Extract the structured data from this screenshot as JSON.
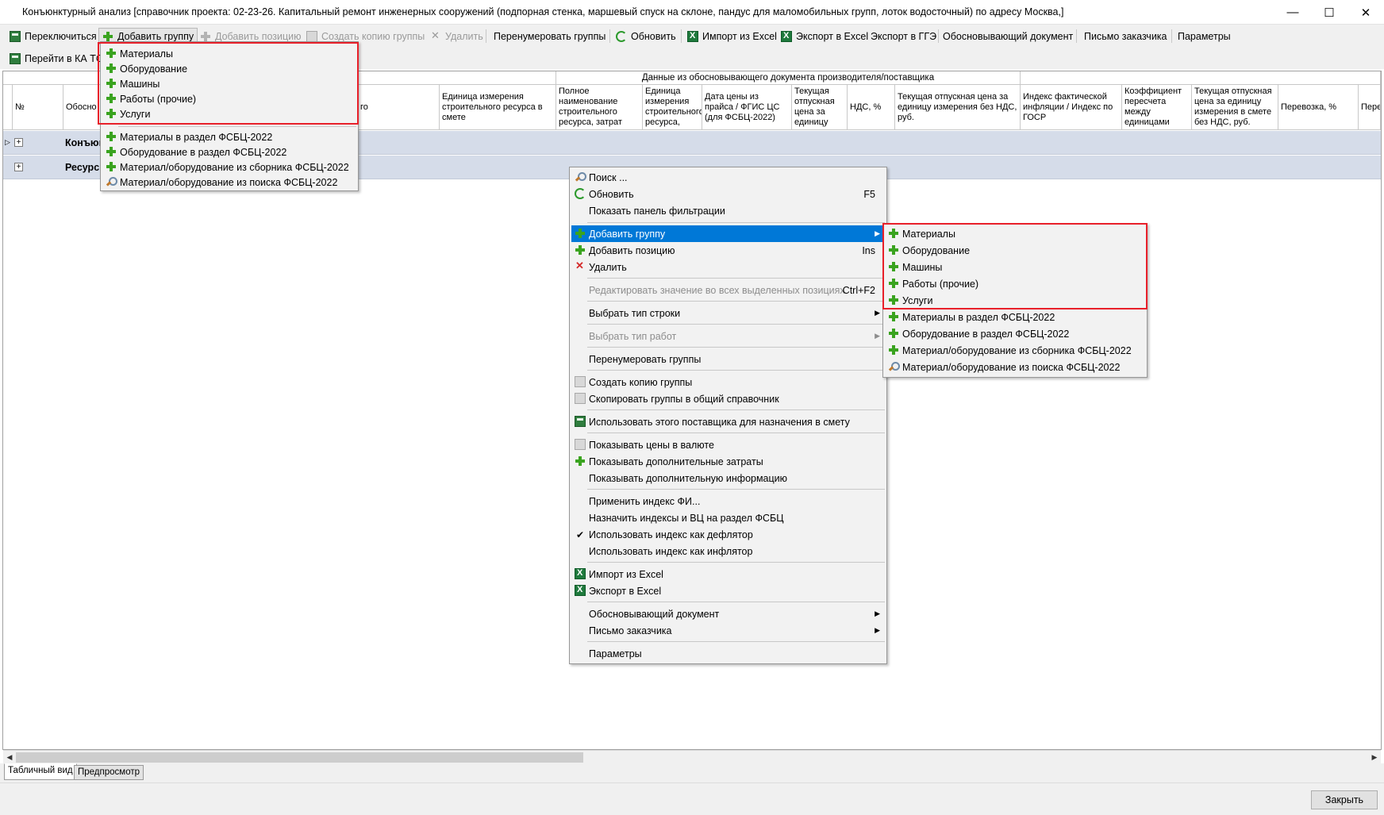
{
  "window": {
    "title": "Конъюнктурный анализ [справочник проекта: 02-23-26. Капитальный ремонт инженерных сооружений (подпорная стенка, маршевый спуск на склоне, пандус для маломобильных групп, лоток водосточный) по адресу Москва,]",
    "minimize": "—",
    "maximize": "☐",
    "close": "✕"
  },
  "toolbar1": {
    "switch": "Переключиться",
    "add_group": "Добавить группу",
    "add_position": "Добавить позицию",
    "create_copy": "Создать копию группы",
    "delete": "Удалить",
    "renumber": "Перенумеровать группы",
    "refresh": "Обновить",
    "import_excel": "Импорт из Excel",
    "export_excel": "Экспорт в Excel",
    "export_gge": "Экспорт в ГГЭ",
    "basis_doc": "Обосновывающий документ",
    "customer_letter": "Письмо заказчика",
    "params": "Параметры"
  },
  "toolbar2": {
    "goto_ka": "Перейти в КА ТС"
  },
  "grid": {
    "group_header": "Данные из обосновывающего документа производителя/поставщика",
    "columns": {
      "num": "№",
      "basis": "Обосно",
      "basis_tail": "го",
      "unit": "Единица измерения строительного ресурса в смете",
      "full_name": "Полное наименование строительного ресурса, затрат",
      "unit2": "Единица измерения строительного ресурса,",
      "price_date": "Дата цены из прайса / ФГИС ЦС (для ФСБЦ-2022)",
      "cur_price": "Текущая отпускная цена за единицу",
      "vat": "НДС, %",
      "cur_price_novat": "Текущая отпускная цена за единицу измерения без НДС, руб.",
      "index": "Индекс фактической инфляции / Индекс по ГОСР",
      "coef": "Коэффициент пересчета между единицами",
      "cur_price_est": "Текущая отпускная цена за единицу измерения в смете без НДС, руб.",
      "transport": "Перевозка, %",
      "more": "Пере"
    },
    "rows": [
      {
        "label": "Конъюн"
      },
      {
        "label": "Ресурсы"
      }
    ]
  },
  "dropdown_menu": {
    "items": [
      "Материалы",
      "Оборудование",
      "Машины",
      "Работы (прочие)",
      "Услуги"
    ],
    "fsbc_items": [
      "Материалы в раздел ФСБЦ-2022",
      "Оборудование в раздел ФСБЦ-2022",
      "Материал/оборудование из сборника ФСБЦ-2022"
    ],
    "search_item": "Материал/оборудование из поиска ФСБЦ-2022"
  },
  "context_menu": {
    "search": "Поиск ...",
    "refresh": "Обновить",
    "refresh_sc": "F5",
    "filter_panel": "Показать панель фильтрации",
    "add_group": "Добавить группу",
    "add_position": "Добавить позицию",
    "add_position_sc": "Ins",
    "delete": "Удалить",
    "edit_all": "Редактировать значение во всех выделенных позициях",
    "edit_all_sc": "Ctrl+F2",
    "row_type": "Выбрать тип строки",
    "work_type": "Выбрать тип работ",
    "renumber": "Перенумеровать группы",
    "create_copy": "Создать копию группы",
    "copy_to_common": "Скопировать группы в общий справочник",
    "use_supplier": "Использовать этого поставщика для назначения в смету",
    "show_currency": "Показывать цены в валюте",
    "show_extra_costs": "Показывать дополнительные затраты",
    "show_extra_info": "Показывать дополнительную информацию",
    "apply_index": "Применить индекс ФИ...",
    "assign_index": "Назначить индексы и ВЦ на раздел ФСБЦ",
    "index_deflator": "Использовать индекс как дефлятор",
    "index_inflator": "Использовать индекс как инфлятор",
    "import_excel": "Импорт из Excel",
    "export_excel": "Экспорт в Excel",
    "basis_doc": "Обосновывающий документ",
    "customer_letter": "Письмо заказчика",
    "params": "Параметры",
    "checkmark": "✔"
  },
  "submenu": {
    "items": [
      "Материалы",
      "Оборудование",
      "Машины",
      "Работы (прочие)",
      "Услуги"
    ],
    "fsbc_items": [
      "Материалы в раздел ФСБЦ-2022",
      "Оборудование в раздел ФСБЦ-2022",
      "Материал/оборудование из сборника ФСБЦ-2022"
    ],
    "search_item": "Материал/оборудование из поиска ФСБЦ-2022"
  },
  "tabs": {
    "table_view": "Табличный вид",
    "preview": "Предпросмотр"
  },
  "footer": {
    "close": "Закрыть"
  },
  "colors": {
    "accent": "#0078d7",
    "highlight_box": "#e8202a",
    "row_bg": "#d5dce9",
    "plus_icon": "#3aa31f"
  }
}
